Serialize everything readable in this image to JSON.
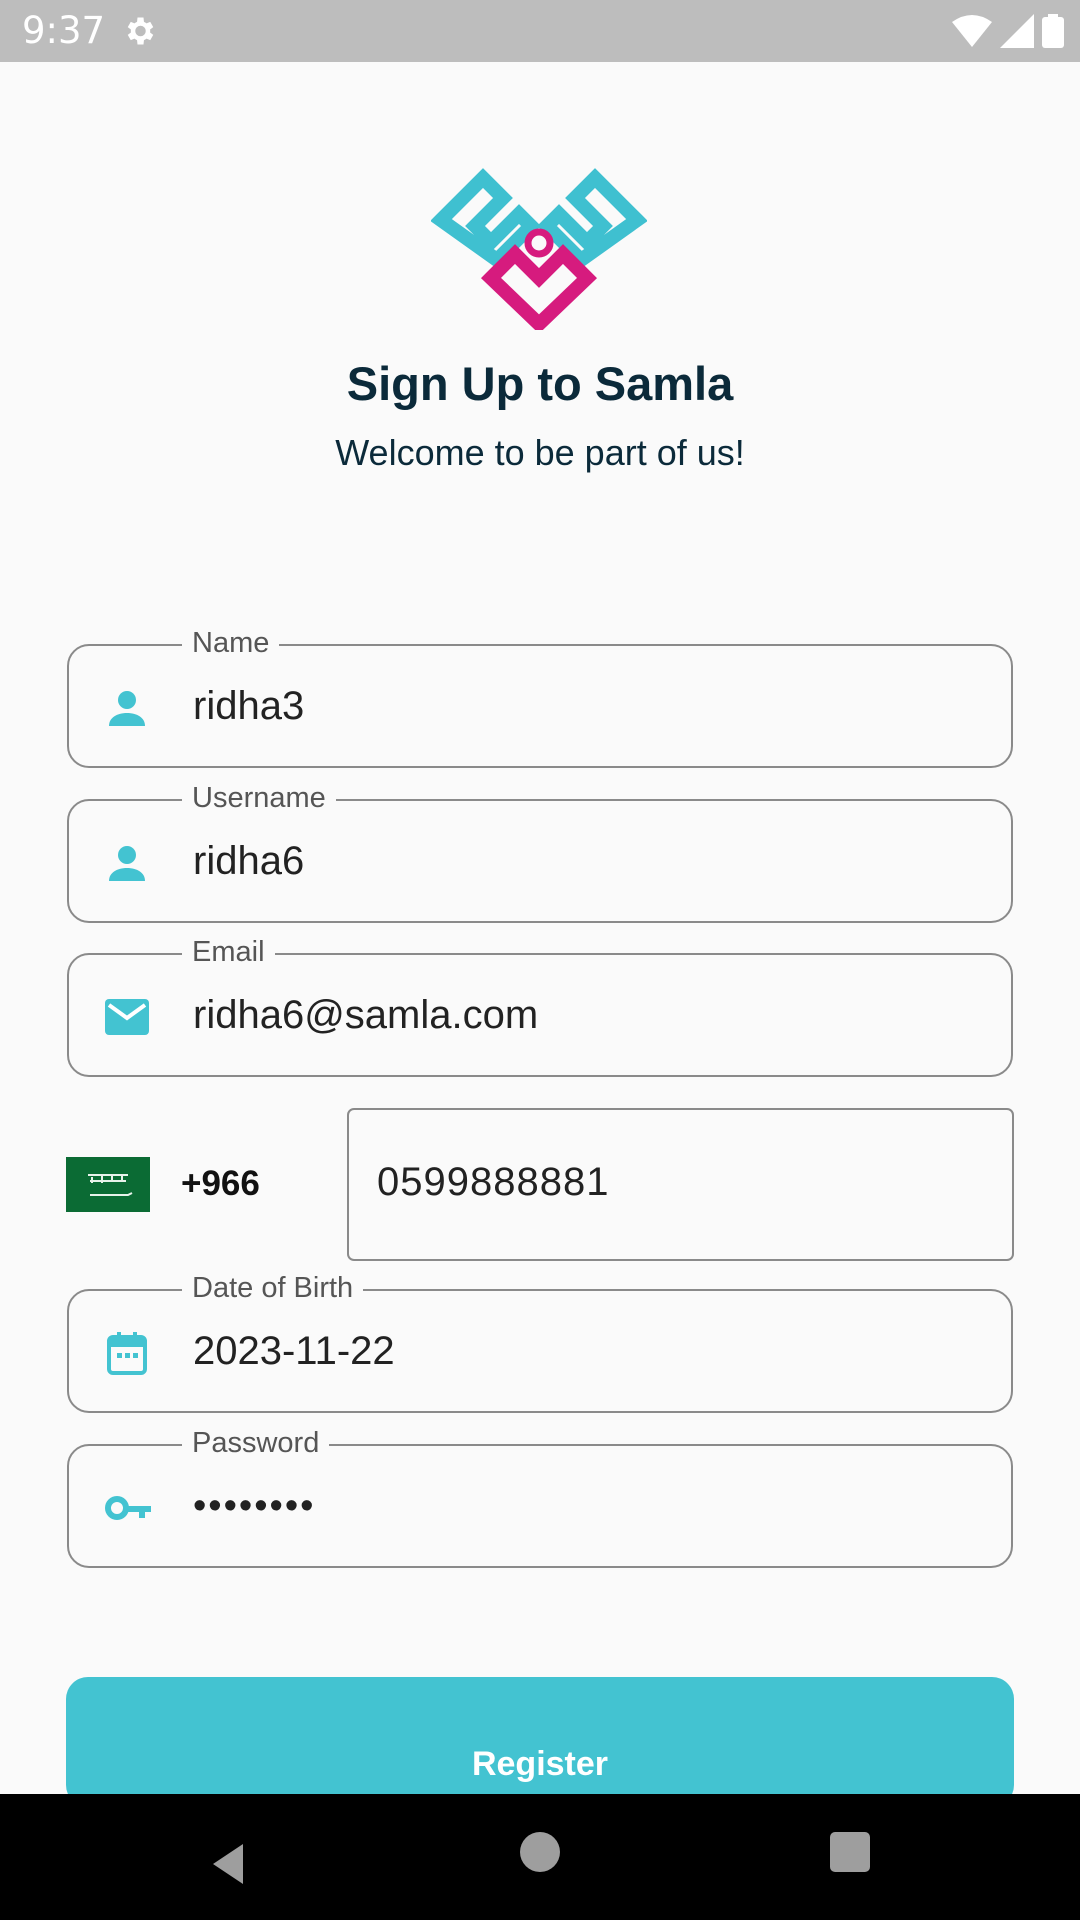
{
  "status_bar": {
    "time": "9:37",
    "icons": [
      "gear-icon",
      "wifi-icon",
      "signal-icon",
      "battery-icon"
    ]
  },
  "header": {
    "title": "Sign Up to Samla",
    "subtitle": "Welcome to be part of us!"
  },
  "form": {
    "name": {
      "label": "Name",
      "value": "ridha3",
      "icon": "person-icon"
    },
    "username": {
      "label": "Username",
      "value": "ridha6",
      "icon": "person-icon"
    },
    "email": {
      "label": "Email",
      "value": "ridha6@samla.com",
      "icon": "mail-icon"
    },
    "phone": {
      "country_code": "+966",
      "value": "0599888881",
      "flag": "saudi-arabia-flag-icon"
    },
    "dob": {
      "label": "Date of Birth",
      "value": "2023-11-22",
      "icon": "calendar-icon"
    },
    "password": {
      "label": "Password",
      "value": "••••••••",
      "icon": "key-icon"
    }
  },
  "actions": {
    "register_label": "Register"
  },
  "colors": {
    "accent": "#43c3d1",
    "brand_pink": "#d61b7e",
    "title": "#0b2a3a"
  },
  "nav": {
    "icons": [
      "back-icon",
      "home-icon",
      "recents-icon"
    ]
  }
}
